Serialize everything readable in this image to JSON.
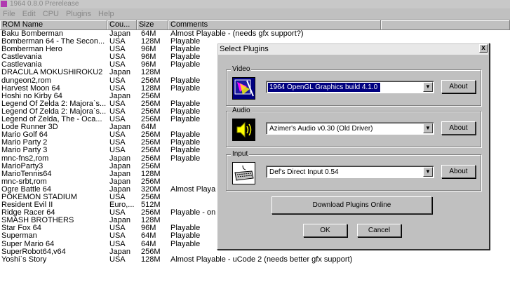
{
  "window": {
    "title": "1964 0.8.0 Prerelease"
  },
  "menu": [
    "File",
    "Edit",
    "CPU",
    "Plugins",
    "Help"
  ],
  "columns": {
    "name": "ROM Name",
    "country": "Cou...",
    "size": "Size",
    "comments": "Comments"
  },
  "roms": [
    {
      "name": "Baku Bomberman",
      "country": "Japan",
      "size": "64M",
      "comments": "Almost Playable - (needs gfx support?)"
    },
    {
      "name": "Bomberman 64 - The Secon...",
      "country": "USA",
      "size": "128M",
      "comments": "Playable"
    },
    {
      "name": "Bomberman Hero",
      "country": "USA",
      "size": "96M",
      "comments": "Playable"
    },
    {
      "name": "Castlevania",
      "country": "USA",
      "size": "96M",
      "comments": "Playable"
    },
    {
      "name": "Castlevania",
      "country": "USA",
      "size": "96M",
      "comments": "Playable"
    },
    {
      "name": "DRACULA MOKUSHIROKU2",
      "country": "Japan",
      "size": "128M",
      "comments": ""
    },
    {
      "name": "dungeon2,rom",
      "country": "USA",
      "size": "256M",
      "comments": "Playable"
    },
    {
      "name": "Harvest Moon 64",
      "country": "USA",
      "size": "128M",
      "comments": "Playable"
    },
    {
      "name": "Hoshi no Kirby 64",
      "country": "Japan",
      "size": "256M",
      "comments": ""
    },
    {
      "name": "Legend Of Zelda 2: Majora`s...",
      "country": "USA",
      "size": "256M",
      "comments": "Playable"
    },
    {
      "name": "Legend Of Zelda 2: Majora`s...",
      "country": "USA",
      "size": "256M",
      "comments": "Playable"
    },
    {
      "name": "Legend of Zelda, The - Oca...",
      "country": "USA",
      "size": "256M",
      "comments": "Playable"
    },
    {
      "name": "Lode Runner 3D",
      "country": "Japan",
      "size": "64M",
      "comments": ""
    },
    {
      "name": "Mario Golf 64",
      "country": "USA",
      "size": "256M",
      "comments": "Playable"
    },
    {
      "name": "Mario Party 2",
      "country": "USA",
      "size": "256M",
      "comments": "Playable"
    },
    {
      "name": "Mario Party 3",
      "country": "USA",
      "size": "256M",
      "comments": "Playable"
    },
    {
      "name": "mnc-fns2,rom",
      "country": "Japan",
      "size": "256M",
      "comments": "Playable"
    },
    {
      "name": "MarioParty3",
      "country": "Japan",
      "size": "256M",
      "comments": ""
    },
    {
      "name": "MarioTennis64",
      "country": "Japan",
      "size": "128M",
      "comments": ""
    },
    {
      "name": "mnc-srbt,rom",
      "country": "Japan",
      "size": "256M",
      "comments": ""
    },
    {
      "name": "Ogre Battle 64",
      "country": "Japan",
      "size": "320M",
      "comments": "Almost Playa"
    },
    {
      "name": "POKEMON STADIUM",
      "country": "USA",
      "size": "256M",
      "comments": ""
    },
    {
      "name": "Resident Evil II",
      "country": "Euro,...",
      "size": "512M",
      "comments": ""
    },
    {
      "name": "Ridge Racer 64",
      "country": "USA",
      "size": "256M",
      "comments": "Playable - on"
    },
    {
      "name": "SMASH BROTHERS",
      "country": "Japan",
      "size": "128M",
      "comments": ""
    },
    {
      "name": "Star Fox 64",
      "country": "USA",
      "size": "96M",
      "comments": "Playable"
    },
    {
      "name": "Superman",
      "country": "USA",
      "size": "64M",
      "comments": "Playable"
    },
    {
      "name": "Super Mario 64",
      "country": "USA",
      "size": "64M",
      "comments": "Playable"
    },
    {
      "name": "SuperRobot64,v64",
      "country": "Japan",
      "size": "256M",
      "comments": ""
    },
    {
      "name": "Yoshi`s Story",
      "country": "USA",
      "size": "128M",
      "comments": "Almost Playable - uCode 2 (needs better gfx support)"
    }
  ],
  "dialog": {
    "title": "Select Plugins",
    "close": "x",
    "video": {
      "label": "Video",
      "value": "1964 OpenGL Graphics build 4.1.0",
      "about": "About",
      "icon": "video-plugin-icon"
    },
    "audio": {
      "label": "Audio",
      "value": "Azimer's Audio v0.30 (Old Driver)",
      "about": "About",
      "icon": "speaker-icon"
    },
    "input": {
      "label": "Input",
      "value": "Def's Direct Input 0.54",
      "about": "About",
      "icon": "keyboard-icon"
    },
    "download": "Download Plugins Online",
    "ok": "OK",
    "cancel": "Cancel"
  }
}
